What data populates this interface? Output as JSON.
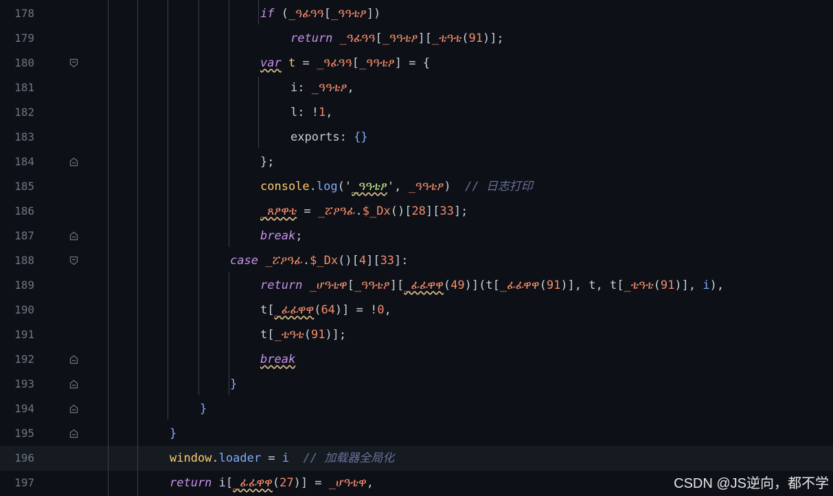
{
  "editor": {
    "lines": [
      {
        "num": "178",
        "tokens": [
          [
            "if",
            "k"
          ],
          [
            " (",
            "p"
          ],
          [
            "_ዓፊዓዓ",
            "id"
          ],
          [
            "[",
            "p"
          ],
          [
            "_ዓዓቴፆ",
            "id"
          ],
          [
            "])",
            "p"
          ]
        ]
      },
      {
        "num": "179",
        "tokens": [
          [
            "return",
            "k"
          ],
          [
            " ",
            "p"
          ],
          [
            "_ዓፊዓዓ",
            "id"
          ],
          [
            "[",
            "p"
          ],
          [
            "_ዓዓቴፆ",
            "id"
          ],
          [
            "][",
            "p"
          ],
          [
            "_ቴዓቴ",
            "id"
          ],
          [
            "(",
            "p"
          ],
          [
            "91",
            "n"
          ],
          [
            ")];",
            "p"
          ]
        ]
      },
      {
        "num": "180",
        "tokens": [
          [
            "var",
            "k"
          ],
          [
            " ",
            "p"
          ],
          [
            "t",
            "v"
          ],
          [
            " = ",
            "p"
          ],
          [
            "_ዓፊዓዓ",
            "id"
          ],
          [
            "[",
            "p"
          ],
          [
            "_ዓዓቴፆ",
            "id"
          ],
          [
            "] = {",
            "p"
          ]
        ]
      },
      {
        "num": "181",
        "tokens": [
          [
            "i",
            "p"
          ],
          [
            ": ",
            "p"
          ],
          [
            "_ዓዓቴፆ",
            "id"
          ],
          [
            ",",
            "p"
          ]
        ]
      },
      {
        "num": "182",
        "tokens": [
          [
            "l",
            "p"
          ],
          [
            ": !",
            "p"
          ],
          [
            "1",
            "n"
          ],
          [
            ",",
            "p"
          ]
        ]
      },
      {
        "num": "183",
        "tokens": [
          [
            "exports",
            "p"
          ],
          [
            ": ",
            "p"
          ],
          [
            "{}",
            "f"
          ]
        ]
      },
      {
        "num": "184",
        "tokens": [
          [
            "};",
            "p"
          ]
        ]
      },
      {
        "num": "185",
        "tokens": [
          [
            "console",
            "cons"
          ],
          [
            ".",
            "p"
          ],
          [
            "log",
            "fn"
          ],
          [
            "('",
            "p"
          ],
          [
            "_ዓዓቴፆ",
            "s"
          ],
          [
            "', ",
            "p"
          ],
          [
            "_ዓዓቴፆ",
            "id"
          ],
          [
            ")  ",
            "p"
          ],
          [
            "// 日志打印",
            "c"
          ]
        ]
      },
      {
        "num": "186",
        "tokens": [
          [
            "_ጸፆዋቴ",
            "id"
          ],
          [
            " = ",
            "p"
          ],
          [
            "_ፘዖዓፊ",
            "id"
          ],
          [
            ".",
            "p"
          ],
          [
            "$_Dx",
            "id"
          ],
          [
            "()[",
            "p"
          ],
          [
            "28",
            "n"
          ],
          [
            "][",
            "p"
          ],
          [
            "33",
            "n"
          ],
          [
            "];",
            "p"
          ]
        ]
      },
      {
        "num": "187",
        "tokens": [
          [
            "break",
            "k"
          ],
          [
            ";",
            "p"
          ]
        ]
      },
      {
        "num": "188",
        "tokens": [
          [
            "case",
            "k"
          ],
          [
            " ",
            "p"
          ],
          [
            "_ፘዖዓፊ",
            "id"
          ],
          [
            ".",
            "p"
          ],
          [
            "$_Dx",
            "id"
          ],
          [
            "()[",
            "p"
          ],
          [
            "4",
            "n"
          ],
          [
            "][",
            "p"
          ],
          [
            "33",
            "n"
          ],
          [
            "]:",
            "p"
          ]
        ]
      },
      {
        "num": "189",
        "tokens": [
          [
            "return",
            "k"
          ],
          [
            " ",
            "p"
          ],
          [
            "_ሆዓቴዋ",
            "id"
          ],
          [
            "[",
            "p"
          ],
          [
            "_ዓዓቴፆ",
            "id"
          ],
          [
            "][",
            "p"
          ],
          [
            "_ፊፊዋዋ",
            "id"
          ],
          [
            "(",
            "p"
          ],
          [
            "49",
            "n"
          ],
          [
            ")](",
            "p"
          ],
          [
            "t",
            "p"
          ],
          [
            "[",
            "p"
          ],
          [
            "_ፊፊዋዋ",
            "id"
          ],
          [
            "(",
            "p"
          ],
          [
            "91",
            "n"
          ],
          [
            ")], t, t[",
            "p"
          ],
          [
            "_ቴዓቴ",
            "id"
          ],
          [
            "(",
            "p"
          ],
          [
            "91",
            "n"
          ],
          [
            ")], ",
            "p"
          ],
          [
            "i",
            "f"
          ],
          [
            "),",
            "p"
          ]
        ]
      },
      {
        "num": "190",
        "tokens": [
          [
            "t[",
            "p"
          ],
          [
            "_ፊፊዋዋ",
            "id"
          ],
          [
            "(",
            "p"
          ],
          [
            "64",
            "n"
          ],
          [
            ")] = !",
            "p"
          ],
          [
            "0",
            "n"
          ],
          [
            ",",
            "p"
          ]
        ]
      },
      {
        "num": "191",
        "tokens": [
          [
            "t[",
            "p"
          ],
          [
            "_ቴዓቴ",
            "id"
          ],
          [
            "(",
            "p"
          ],
          [
            "91",
            "n"
          ],
          [
            ")];",
            "p"
          ]
        ]
      },
      {
        "num": "192",
        "tokens": [
          [
            "break",
            "k"
          ]
        ]
      },
      {
        "num": "193",
        "tokens": [
          [
            "}",
            "f"
          ]
        ]
      },
      {
        "num": "194",
        "tokens": [
          [
            "}",
            "f"
          ]
        ]
      },
      {
        "num": "195",
        "tokens": [
          [
            "}",
            "f"
          ]
        ]
      },
      {
        "num": "196",
        "tokens": [
          [
            "window",
            "cons"
          ],
          [
            ".",
            "p"
          ],
          [
            "loader",
            "fn"
          ],
          [
            " = ",
            "p"
          ],
          [
            "i",
            "f"
          ],
          [
            "  ",
            "p"
          ],
          [
            "// 加载器全局化",
            "c"
          ]
        ]
      },
      {
        "num": "197",
        "tokens": [
          [
            "return",
            "k"
          ],
          [
            " i[",
            "p"
          ],
          [
            "_ፊፊዋዋ",
            "id"
          ],
          [
            "(",
            "p"
          ],
          [
            "27",
            "n"
          ],
          [
            ")] = ",
            "p"
          ],
          [
            "_ሆዓቴዋ",
            "id"
          ],
          [
            ",",
            "p"
          ]
        ]
      }
    ]
  },
  "watermark": "CSDN @JS逆向，都不学"
}
